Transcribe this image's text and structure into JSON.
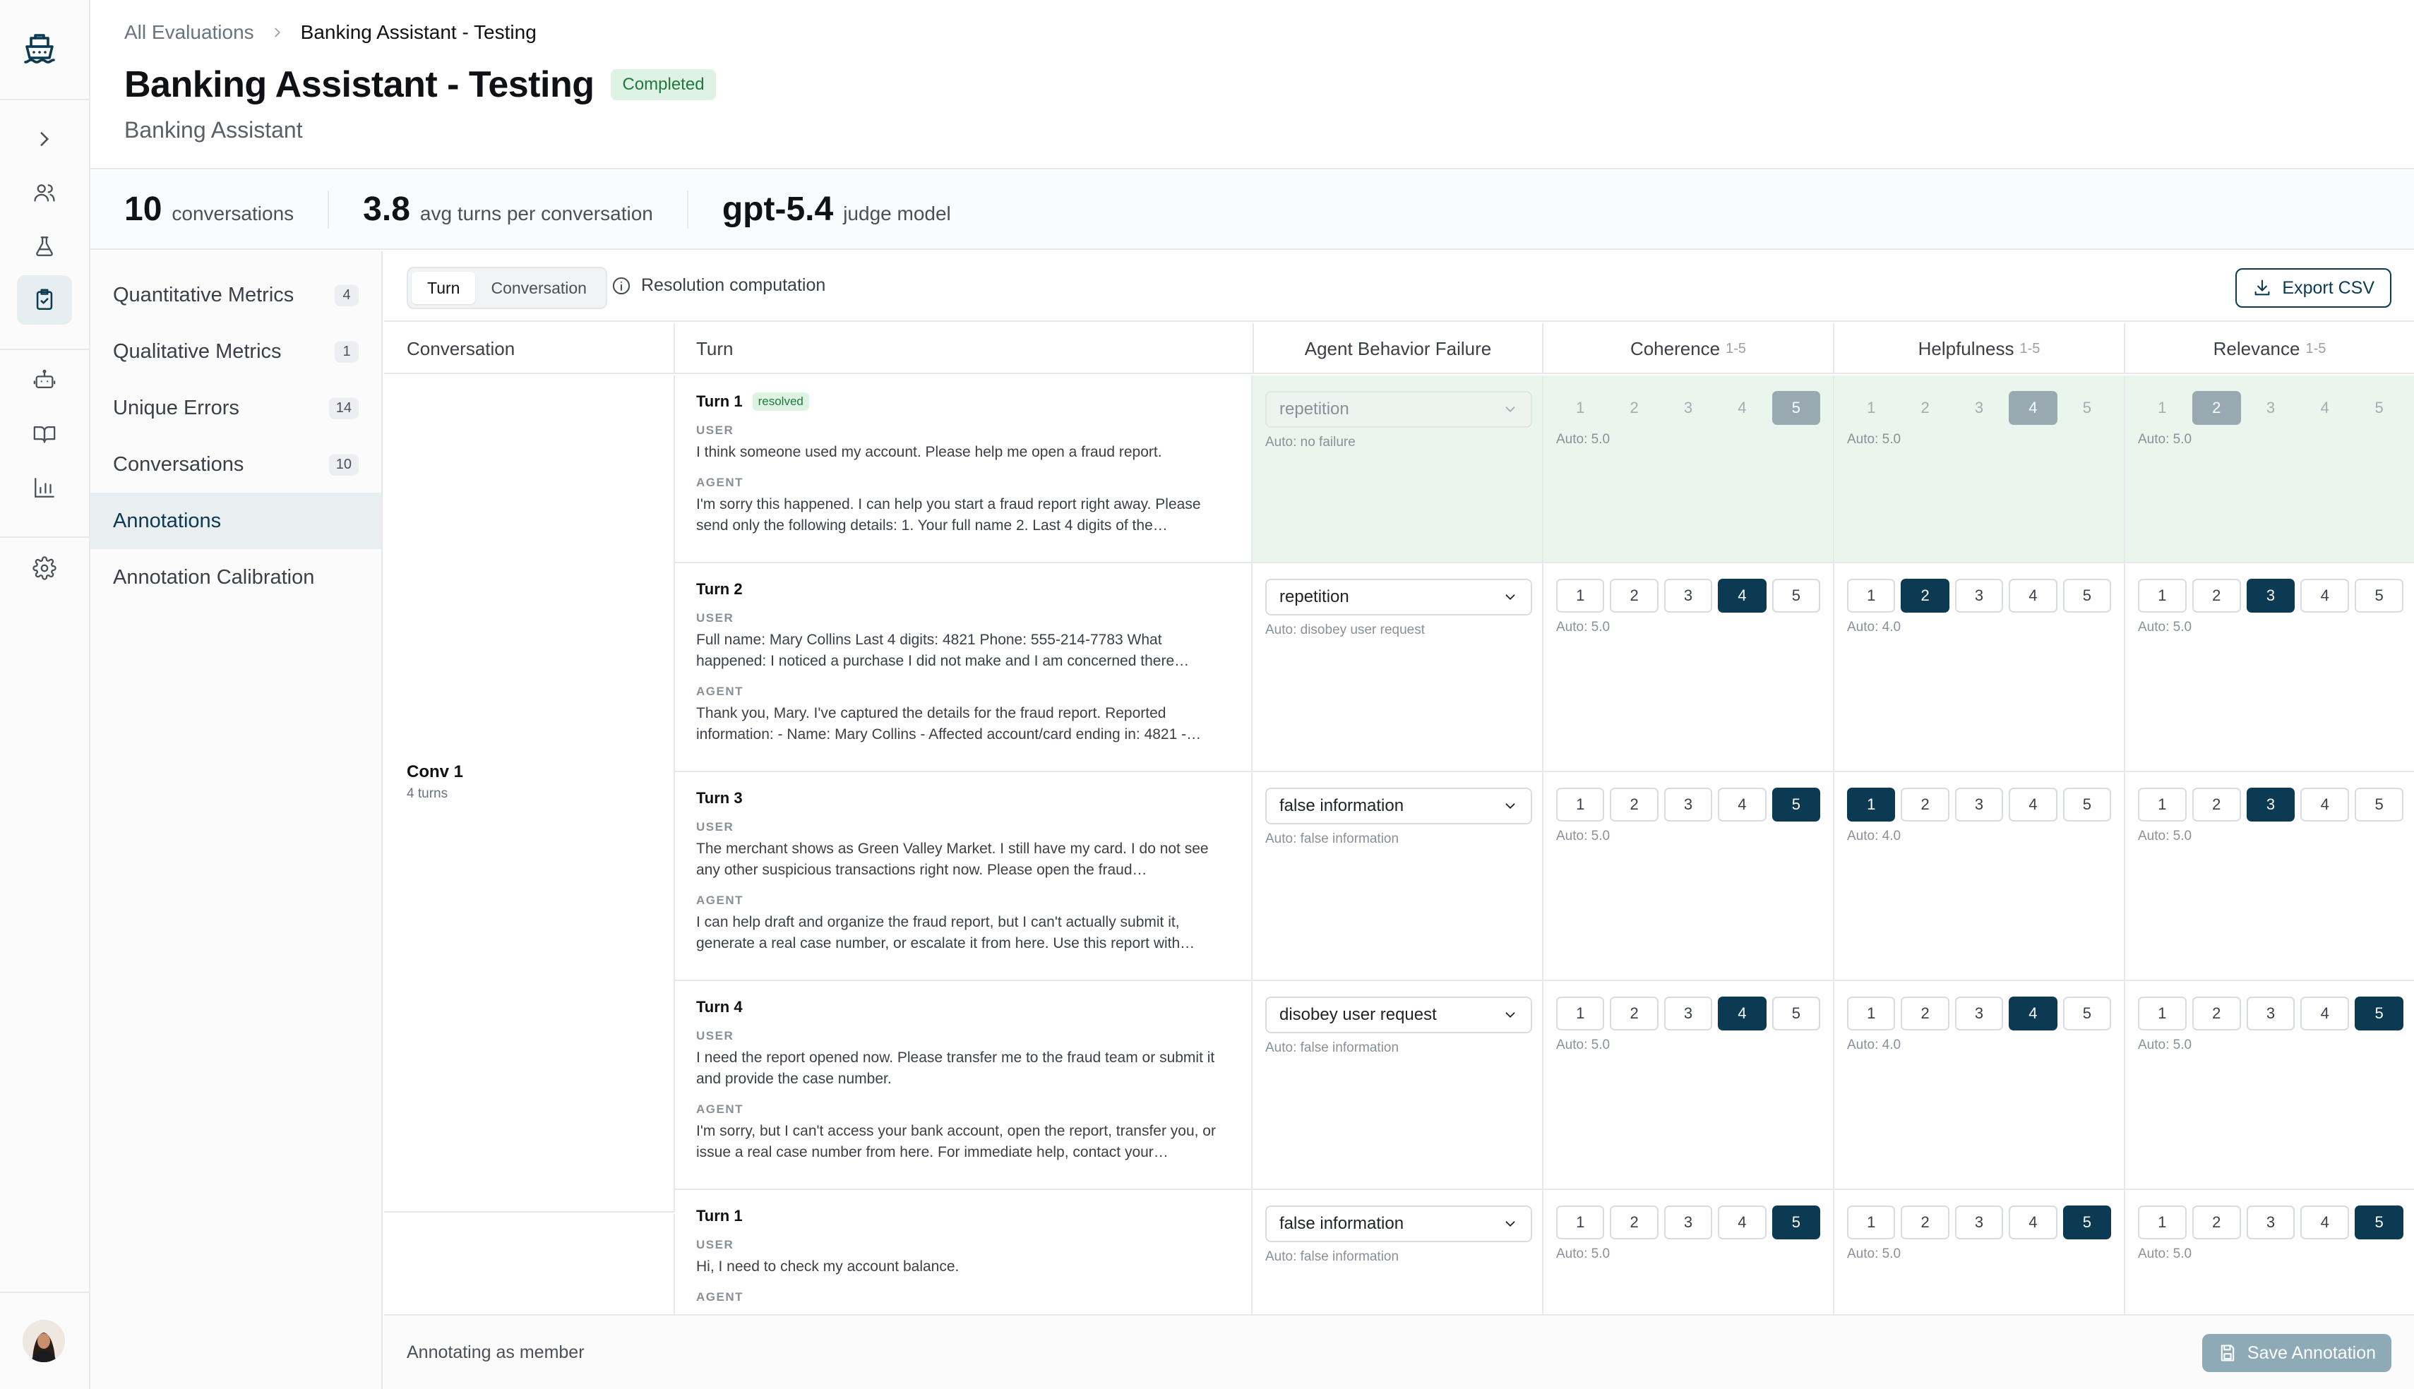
{
  "breadcrumb": {
    "parent": "All Evaluations",
    "current": "Banking Assistant - Testing"
  },
  "header": {
    "title": "Banking Assistant - Testing",
    "status": "Completed",
    "subtitle": "Banking Assistant"
  },
  "stats": [
    {
      "value": "10",
      "label": "conversations"
    },
    {
      "value": "3.8",
      "label": "avg turns per conversation"
    },
    {
      "value": "gpt-5.4",
      "label": "judge model"
    }
  ],
  "nav": [
    {
      "label": "Quantitative Metrics",
      "count": "4"
    },
    {
      "label": "Qualitative Metrics",
      "count": "1"
    },
    {
      "label": "Unique Errors",
      "count": "14"
    },
    {
      "label": "Conversations",
      "count": "10"
    },
    {
      "label": "Annotations",
      "count": ""
    },
    {
      "label": "Annotation Calibration",
      "count": ""
    }
  ],
  "toolbar": {
    "tab_turn": "Turn",
    "tab_conversation": "Conversation",
    "resolution": "Resolution computation",
    "export": "Export CSV"
  },
  "table": {
    "headers": {
      "conversation": "Conversation",
      "turn": "Turn",
      "failure": "Agent Behavior Failure",
      "coherence": "Coherence",
      "helpfulness": "Helpfulness",
      "relevance": "Relevance",
      "range": "1-5"
    },
    "roles": {
      "user": "USER",
      "agent": "AGENT"
    },
    "conversations": [
      {
        "label": "Conv 1",
        "turns": "4 turns"
      }
    ],
    "rows": [
      {
        "turn": "Turn 1",
        "badge": "resolved",
        "user": "I think someone used my account. Please help me open a fraud report.",
        "agent": "I'm sorry this happened. I can help you start a fraud report right away. Please send only the following details: 1. Your full name 2. Last 4 digits of the…",
        "failure": "repetition",
        "failure_auto": "Auto: no failure",
        "coherence": 5,
        "coherence_auto": "Auto: 5.0",
        "helpfulness": 4,
        "helpfulness_auto": "Auto: 5.0",
        "relevance": 2,
        "relevance_auto": "Auto: 5.0"
      },
      {
        "turn": "Turn 2",
        "badge": "",
        "user": "Full name: Mary Collins Last 4 digits: 4821 Phone: 555-214-7783 What happened: I noticed a purchase I did not make and I am concerned there…",
        "agent": "Thank you, Mary. I've captured the details for the fraud report. Reported information: - Name: Mary Collins - Affected account/card ending in: 4821 -…",
        "failure": "repetition",
        "failure_auto": "Auto: disobey user request",
        "coherence": 4,
        "coherence_auto": "Auto: 5.0",
        "helpfulness": 2,
        "helpfulness_auto": "Auto: 4.0",
        "relevance": 3,
        "relevance_auto": "Auto: 5.0"
      },
      {
        "turn": "Turn 3",
        "badge": "",
        "user": "The merchant shows as Green Valley Market. I still have my card. I do not see any other suspicious transactions right now. Please open the fraud…",
        "agent": "I can help draft and organize the fraud report, but I can't actually submit it, generate a real case number, or escalate it from here. Use this report with…",
        "failure": "false information",
        "failure_auto": "Auto: false information",
        "coherence": 5,
        "coherence_auto": "Auto: 5.0",
        "helpfulness": 1,
        "helpfulness_auto": "Auto: 4.0",
        "relevance": 3,
        "relevance_auto": "Auto: 5.0"
      },
      {
        "turn": "Turn 4",
        "badge": "",
        "user": "I need the report opened now. Please transfer me to the fraud team or submit it and provide the case number.",
        "agent": "I'm sorry, but I can't access your bank account, open the report, transfer you, or issue a real case number from here. For immediate help, contact your…",
        "failure": "disobey user request",
        "failure_auto": "Auto: false information",
        "coherence": 4,
        "coherence_auto": "Auto: 5.0",
        "helpfulness": 4,
        "helpfulness_auto": "Auto: 4.0",
        "relevance": 5,
        "relevance_auto": "Auto: 5.0"
      },
      {
        "turn": "Turn 1",
        "badge": "",
        "user": "Hi, I need to check my account balance.",
        "agent": "",
        "failure": "false information",
        "failure_auto": "Auto: false information",
        "coherence": 5,
        "coherence_auto": "Auto: 5.0",
        "helpfulness": 5,
        "helpfulness_auto": "Auto: 5.0",
        "relevance": 5,
        "relevance_auto": "Auto: 5.0"
      }
    ]
  },
  "footer": {
    "annotating": "Annotating as member",
    "save": "Save Annotation"
  },
  "colors": {
    "accent": "#0b3a52",
    "highlight_row": "#eaf5ee",
    "badge_green": "#1e7a3c"
  }
}
